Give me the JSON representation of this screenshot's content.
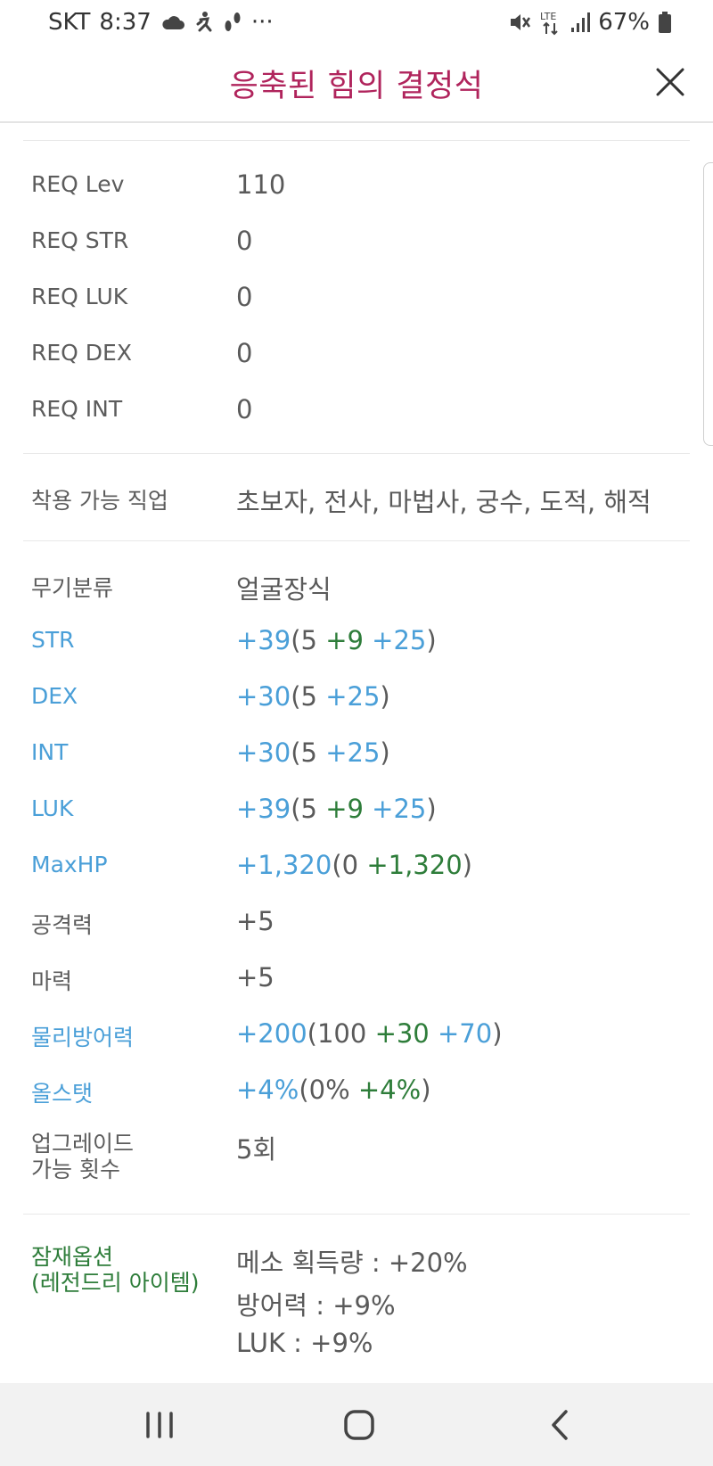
{
  "status_bar": {
    "carrier": "SKT",
    "time": "8:37",
    "more": "···",
    "network": "LTE",
    "battery": "67%"
  },
  "header": {
    "title": "응축된 힘의 결정석"
  },
  "requirements": [
    {
      "label": "REQ Lev",
      "value": "110"
    },
    {
      "label": "REQ STR",
      "value": "0"
    },
    {
      "label": "REQ LUK",
      "value": "0"
    },
    {
      "label": "REQ DEX",
      "value": "0"
    },
    {
      "label": "REQ INT",
      "value": "0"
    }
  ],
  "jobs": {
    "label": "착용 가능 직업",
    "value": "초보자, 전사, 마법사, 궁수, 도적, 해적"
  },
  "stats": {
    "category": {
      "label": "무기분류",
      "value": "얼굴장식"
    },
    "str": {
      "label": "STR",
      "total": "+39",
      "open": "(",
      "base": "5 ",
      "bonus": "+9",
      "enhance": " +25",
      "close": ")"
    },
    "dex": {
      "label": "DEX",
      "total": "+30",
      "open": "(",
      "base": "5",
      "enhance": " +25",
      "close": ")"
    },
    "int": {
      "label": "INT",
      "total": "+30",
      "open": "(",
      "base": "5",
      "enhance": " +25",
      "close": ")"
    },
    "luk": {
      "label": "LUK",
      "total": "+39",
      "open": "(",
      "base": "5 ",
      "bonus": "+9",
      "enhance": " +25",
      "close": ")"
    },
    "maxhp": {
      "label": "MaxHP",
      "total": "+1,320",
      "open": "(",
      "base": "0 ",
      "bonus": "+1,320",
      "close": ")"
    },
    "attack": {
      "label": "공격력",
      "value": "+5"
    },
    "magic": {
      "label": "마력",
      "value": "+5"
    },
    "defense": {
      "label": "물리방어력",
      "total": "+200",
      "open": "(",
      "base": "100 ",
      "bonus": "+30",
      "enhance": " +70",
      "close": ")"
    },
    "allstat": {
      "label": "올스탯",
      "total": "+4%",
      "open": "(",
      "base": "0% ",
      "bonus": "+4%",
      "close": ")"
    },
    "upgrade": {
      "label_line1": "업그레이드",
      "label_line2": "가능 횟수",
      "value": "5회"
    }
  },
  "potential": {
    "label_line1": "잠재옵션",
    "label_line2": "(레전드리 아이템)",
    "lines": [
      "메소 획득량 : +20%",
      "방어력 : +9%",
      "LUK : +9%"
    ]
  },
  "colors": {
    "title": "#b0245c",
    "stat_blue": "#4a9fd8",
    "stat_green": "#2e7d3a",
    "text_gray": "#5a5a5a"
  }
}
